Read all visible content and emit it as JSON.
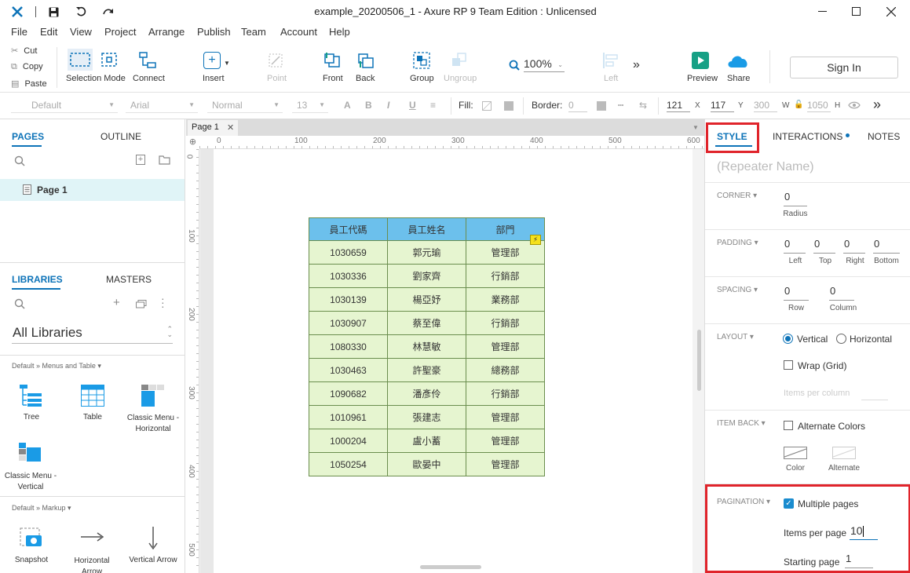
{
  "window": {
    "title": "example_20200506_1 - Axure RP 9 Team Edition : Unlicensed"
  },
  "menu": [
    "File",
    "Edit",
    "View",
    "Project",
    "Arrange",
    "Publish",
    "Team",
    "Account",
    "Help"
  ],
  "clipboard": {
    "cut": "Cut",
    "copy": "Copy",
    "paste": "Paste"
  },
  "toolbar": {
    "selection_mode": "Selection Mode",
    "connect": "Connect",
    "insert": "Insert",
    "point": "Point",
    "front": "Front",
    "back": "Back",
    "group": "Group",
    "ungroup": "Ungroup",
    "zoom": "100%",
    "left": "Left",
    "preview": "Preview",
    "share": "Share",
    "sign_in": "Sign In"
  },
  "stylebar": {
    "style": "Default",
    "font": "Arial",
    "weight": "Normal",
    "size": "13",
    "fill_label": "Fill:",
    "border_label": "Border:",
    "border_value": "0",
    "x": "121",
    "x_label": "X",
    "y": "117",
    "y_label": "Y",
    "w": "300",
    "w_label": "W",
    "h": "1050",
    "h_label": "H"
  },
  "left_panel": {
    "pages_tab": "PAGES",
    "outline_tab": "OUTLINE",
    "page_item": "Page 1",
    "libraries_tab": "LIBRARIES",
    "masters_tab": "MASTERS",
    "library_select": "All Libraries",
    "group1": "Default » Menus and Table",
    "group2": "Default » Markup",
    "widgets1": [
      {
        "label": "Tree",
        "icon": "tree-widget-icon"
      },
      {
        "label": "Table",
        "icon": "table-widget-icon"
      },
      {
        "label": "Classic Menu - Horizontal",
        "icon": "classic-menu-horizontal-icon"
      },
      {
        "label": "Classic Menu - Vertical",
        "icon": "classic-menu-vertical-icon"
      }
    ],
    "widgets2": [
      {
        "label": "Snapshot",
        "icon": "snapshot-icon"
      },
      {
        "label": "Horizontal Arrow",
        "icon": "horizontal-arrow-icon"
      },
      {
        "label": "Vertical Arrow",
        "icon": "vertical-arrow-icon"
      }
    ]
  },
  "canvas": {
    "tab": "Page 1",
    "ruler_h": [
      "0",
      "100",
      "200",
      "300",
      "400",
      "500",
      "600"
    ],
    "ruler_v": [
      "0",
      "100",
      "200",
      "300",
      "400",
      "500"
    ],
    "table": {
      "headers": [
        "員工代碼",
        "員工姓名",
        "部門"
      ],
      "rows": [
        [
          "1030659",
          "郭元瑜",
          "管理部"
        ],
        [
          "1030336",
          "劉家齊",
          "行銷部"
        ],
        [
          "1030139",
          "楊亞妤",
          "業務部"
        ],
        [
          "1030907",
          "蔡至偉",
          "行銷部"
        ],
        [
          "1080330",
          "林慧敏",
          "管理部"
        ],
        [
          "1030463",
          "許聖豪",
          "總務部"
        ],
        [
          "1090682",
          "潘彥伶",
          "行銷部"
        ],
        [
          "1010961",
          "張建志",
          "管理部"
        ],
        [
          "1000204",
          "盧小蓄",
          "管理部"
        ],
        [
          "1050254",
          "歐晏中",
          "管理部"
        ]
      ]
    }
  },
  "right_panel": {
    "tabs": {
      "style": "STYLE",
      "interactions": "INTERACTIONS",
      "notes": "NOTES"
    },
    "repeater_name_placeholder": "(Repeater Name)",
    "corner": {
      "label": "CORNER",
      "value": "0",
      "sub": "Radius"
    },
    "padding": {
      "label": "PADDING",
      "values": [
        "0",
        "0",
        "0",
        "0"
      ],
      "subs": [
        "Left",
        "Top",
        "Right",
        "Bottom"
      ]
    },
    "spacing": {
      "label": "SPACING",
      "values": [
        "0",
        "0"
      ],
      "subs": [
        "Row",
        "Column"
      ]
    },
    "layout": {
      "label": "LAYOUT",
      "vertical": "Vertical",
      "horizontal": "Horizontal",
      "wrap": "Wrap (Grid)",
      "items_per_column": "Items per column"
    },
    "item_back": {
      "label": "ITEM BACK",
      "alternate_colors": "Alternate Colors",
      "color": "Color",
      "alternate": "Alternate"
    },
    "pagination": {
      "label": "PAGINATION",
      "multiple_pages": "Multiple pages",
      "items_per_page_label": "Items per page",
      "items_per_page": "10",
      "starting_page_label": "Starting page",
      "starting_page": "1"
    }
  },
  "colors": {
    "accent": "#0d73b8",
    "header_fill": "#6cc0ec",
    "row_fill": "#e6f5d0",
    "highlight": "#e0242b"
  }
}
